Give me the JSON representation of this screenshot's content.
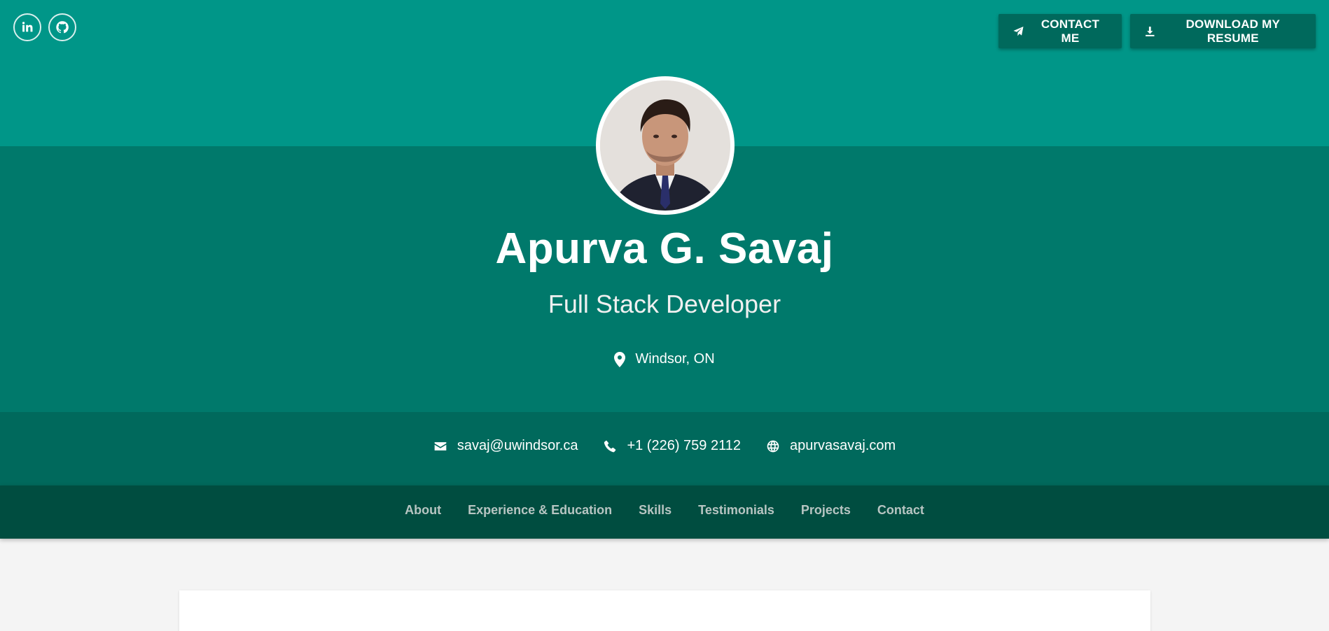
{
  "social": {
    "linkedin_icon": "linkedin-icon",
    "github_icon": "github-icon"
  },
  "actions": {
    "contact_label": "CONTACT ME",
    "contact_icon": "paper-plane-icon",
    "resume_label": "DOWNLOAD MY RESUME",
    "resume_icon": "download-icon"
  },
  "profile": {
    "name": "Apurva G. Savaj",
    "title": "Full Stack Developer",
    "location": "Windsor, ON",
    "location_icon": "map-marker-icon"
  },
  "contact_info": {
    "email": "savaj@uwindsor.ca",
    "phone": "+1 (226) 759 2112",
    "website": "apurvasavaj.com"
  },
  "nav": {
    "items": [
      "About",
      "Experience & Education",
      "Skills",
      "Testimonials",
      "Projects",
      "Contact"
    ]
  },
  "colors": {
    "hero_top": "#009688",
    "hero_mid": "#00796b",
    "contact_bar": "#00695c",
    "nav_bar": "#004d40",
    "page_bg": "#f4f4f4"
  }
}
